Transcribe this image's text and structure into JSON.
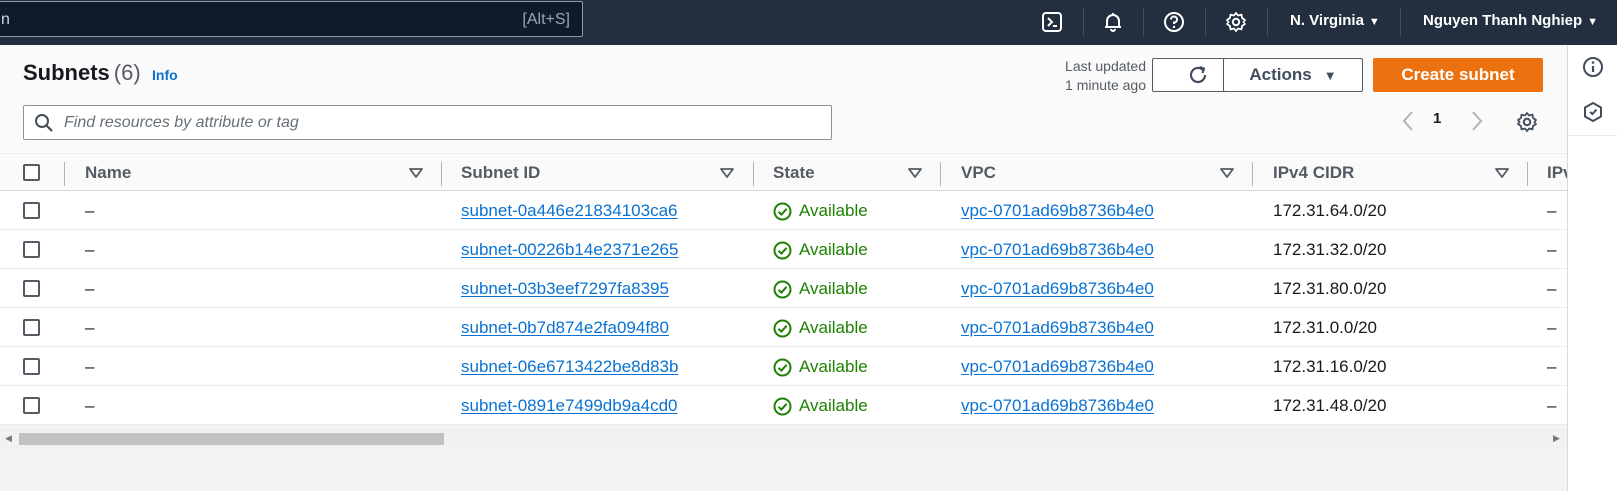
{
  "topnav": {
    "search_lead": "n",
    "search_shortcut": "[Alt+S]",
    "icons": [
      "cloudshell-icon",
      "bell-icon",
      "help-icon",
      "settings-icon"
    ],
    "region": "N. Virginia",
    "user": "Nguyen Thanh Nghiep"
  },
  "header": {
    "title": "Subnets",
    "count": "(6)",
    "info": "Info",
    "last_updated_line1": "Last updated",
    "last_updated_line2": "1 minute ago",
    "actions_label": "Actions",
    "create_label": "Create subnet",
    "filter_placeholder": "Find resources by attribute or tag",
    "page": "1"
  },
  "table": {
    "columns": [
      "Name",
      "Subnet ID",
      "State",
      "VPC",
      "IPv4 CIDR",
      "IPv"
    ],
    "rows": [
      {
        "name": "–",
        "subnet_id": "subnet-0a446e21834103ca6",
        "state": "Available",
        "vpc": "vpc-0701ad69b8736b4e0",
        "cidr": "172.31.64.0/20",
        "ipv6": "–"
      },
      {
        "name": "–",
        "subnet_id": "subnet-00226b14e2371e265",
        "state": "Available",
        "vpc": "vpc-0701ad69b8736b4e0",
        "cidr": "172.31.32.0/20",
        "ipv6": "–"
      },
      {
        "name": "–",
        "subnet_id": "subnet-03b3eef7297fa8395",
        "state": "Available",
        "vpc": "vpc-0701ad69b8736b4e0",
        "cidr": "172.31.80.0/20",
        "ipv6": "–"
      },
      {
        "name": "–",
        "subnet_id": "subnet-0b7d874e2fa094f80",
        "state": "Available",
        "vpc": "vpc-0701ad69b8736b4e0",
        "cidr": "172.31.0.0/20",
        "ipv6": "–"
      },
      {
        "name": "–",
        "subnet_id": "subnet-06e6713422be8d83b",
        "state": "Available",
        "vpc": "vpc-0701ad69b8736b4e0",
        "cidr": "172.31.16.0/20",
        "ipv6": "–"
      },
      {
        "name": "–",
        "subnet_id": "subnet-0891e7499db9a4cd0",
        "state": "Available",
        "vpc": "vpc-0701ad69b8736b4e0",
        "cidr": "172.31.48.0/20",
        "ipv6": "–"
      }
    ]
  },
  "colors": {
    "nav_bg": "#232f3e",
    "primary": "#ec7211",
    "link": "#0972d3",
    "success": "#1d8102"
  }
}
